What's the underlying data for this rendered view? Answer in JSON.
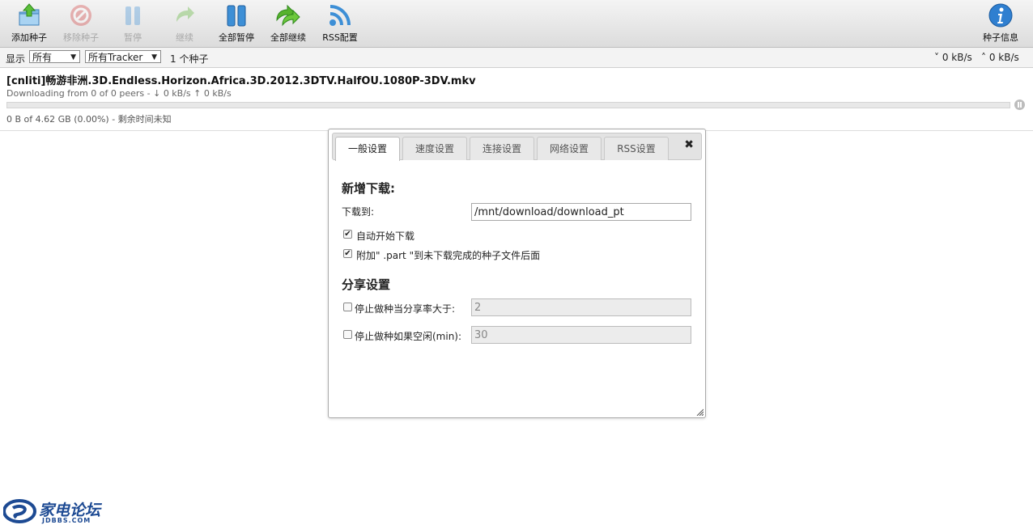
{
  "toolbar": {
    "buttons": [
      {
        "label": "添加种子",
        "enabled": true
      },
      {
        "label": "移除种子",
        "enabled": false
      },
      {
        "label": "暂停",
        "enabled": false
      },
      {
        "label": "继续",
        "enabled": false
      },
      {
        "label": "全部暂停",
        "enabled": true
      },
      {
        "label": "全部继续",
        "enabled": true
      },
      {
        "label": "RSS配置",
        "enabled": true
      }
    ],
    "info_label": "种子信息"
  },
  "filter": {
    "show_label": "显示",
    "status_value": "所有",
    "tracker_value": "所有Tracker",
    "count": "1 个种子",
    "download_speed": "0 kB/s",
    "upload_speed": "0 kB/s"
  },
  "torrent": {
    "name": "[cnliti]畅游非洲.3D.Endless.Horizon.Africa.3D.2012.3DTV.HalfOU.1080P-3DV.mkv",
    "peers": "Downloading from 0 of 0 peers - ↓ 0 kB/s ↑ 0 kB/s",
    "progress_percent": 0,
    "progress_text": "0 B of 4.62 GB (0.00%) - 剩余时间未知"
  },
  "dialog": {
    "tabs": [
      "一般设置",
      "速度设置",
      "连接设置",
      "网络设置",
      "RSS设置"
    ],
    "active_tab": 0,
    "close": "✖",
    "new_download": {
      "title": "新增下载:",
      "download_to_label": "下载到:",
      "download_to_value": "/mnt/download/download_pt",
      "auto_start_label": "自动开始下载",
      "auto_start_checked": true,
      "append_part_label": "附加\" .part \"到未下载完成的种子文件后面",
      "append_part_checked": true
    },
    "share": {
      "title": "分享设置",
      "ratio_label": "停止做种当分享率大于:",
      "ratio_checked": false,
      "ratio_value": "2",
      "idle_label": "停止做种如果空闲(min):",
      "idle_checked": false,
      "idle_value": "30"
    }
  },
  "watermark": {
    "name": "家电论坛",
    "site": "JDBBS.COM"
  },
  "colors": {
    "icon_blue": "#3d8fd6",
    "icon_green": "#57b22d",
    "icon_red": "#d33b3b",
    "brand": "#1d4a93"
  }
}
